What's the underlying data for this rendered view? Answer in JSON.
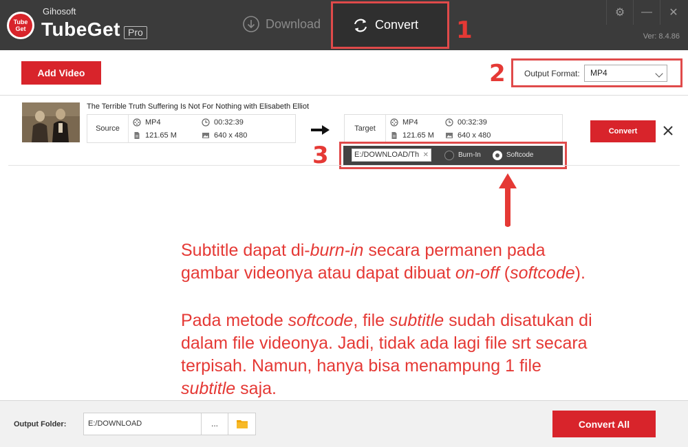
{
  "app": {
    "vendor": "Gihosoft",
    "name": "TubeGet",
    "edition": "Pro",
    "logo_text": "Tube Get",
    "version": "Ver: 8.4.86"
  },
  "nav": {
    "download_label": "Download",
    "convert_label": "Convert"
  },
  "toolbar": {
    "add_video_label": "Add Video",
    "output_format_label": "Output Format:",
    "output_format_value": "MP4"
  },
  "item": {
    "title": "The Terrible Truth Suffering Is Not For Nothing with Elisabeth Elliot",
    "source": {
      "label": "Source",
      "format": "MP4",
      "duration": "00:32:39",
      "size": "121.65 M",
      "resolution": "640 x 480"
    },
    "target": {
      "label": "Target",
      "format": "MP4",
      "duration": "00:32:39",
      "size": "121.65 M",
      "resolution": "640 x 480"
    },
    "convert_label": "Convert",
    "subtitle": {
      "path": "E:/DOWNLOAD/Th",
      "burn_in_label": "Burn-In",
      "softcode_label": "Softcode",
      "selected": "Softcode"
    }
  },
  "annotations": {
    "n1": "1",
    "n2": "2",
    "n3": "3",
    "para1_line1_a": "Subtitle dapat di-",
    "para1_line1_b": "burn-in",
    "para1_line1_c": " secara permanen pada",
    "para1_line2_a": "gambar videonya atau dapat dibuat ",
    "para1_line2_b": "on-off",
    "para1_line2_c": " (",
    "para1_line2_d": "softcode",
    "para1_line2_e": ").",
    "para2_line1_a": "Pada metode ",
    "para2_line1_b": "softcode",
    "para2_line1_c": ", file ",
    "para2_line1_d": "subtitle",
    "para2_line1_e": " sudah disatukan di",
    "para2_line2": "dalam file videonya. Jadi, tidak ada lagi file srt secara",
    "para2_line3": "terpisah. Namun, hanya bisa menampung 1 file",
    "para2_line4_a": "subtitle",
    "para2_line4_b": " saja."
  },
  "bottom": {
    "output_folder_label": "Output Folder:",
    "output_folder_value": "E:/DOWNLOAD",
    "browse_label": "...",
    "convert_all_label": "Convert All"
  },
  "colors": {
    "accent_red": "#d8242b",
    "annotation_red": "#e53935",
    "titlebar": "#3b3b3b"
  }
}
